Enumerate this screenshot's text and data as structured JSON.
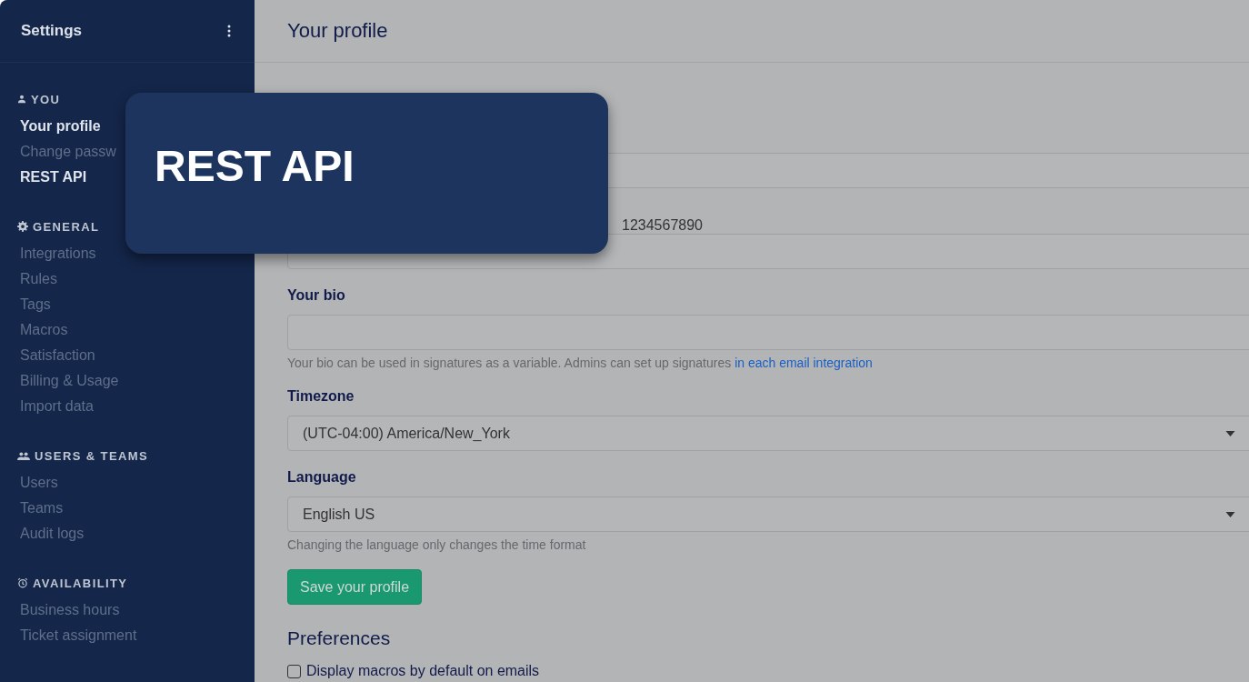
{
  "sidebar": {
    "title": "Settings",
    "sections": [
      {
        "heading": "YOU",
        "items": [
          {
            "label": "Your profile",
            "highlighted": true
          },
          {
            "label": "Change passw",
            "highlighted": false
          },
          {
            "label": "REST API",
            "highlighted": true
          }
        ]
      },
      {
        "heading": "GENERAL",
        "items": [
          {
            "label": "Integrations",
            "highlighted": false
          },
          {
            "label": "Rules",
            "highlighted": false
          },
          {
            "label": "Tags",
            "highlighted": false
          },
          {
            "label": "Macros",
            "highlighted": false
          },
          {
            "label": "Satisfaction",
            "highlighted": false
          },
          {
            "label": "Billing & Usage",
            "highlighted": false
          },
          {
            "label": "Import data",
            "highlighted": false
          }
        ]
      },
      {
        "heading": "USERS & TEAMS",
        "items": [
          {
            "label": "Users",
            "highlighted": false
          },
          {
            "label": "Teams",
            "highlighted": false
          },
          {
            "label": "Audit logs",
            "highlighted": false
          }
        ]
      },
      {
        "heading": "AVAILABILITY",
        "items": [
          {
            "label": "Business hours",
            "highlighted": false
          },
          {
            "label": "Ticket assignment",
            "highlighted": false
          }
        ]
      }
    ]
  },
  "page": {
    "title": "Your profile",
    "fields": [
      {
        "kind": "input"
      },
      {
        "kind": "input"
      },
      {
        "kind": "input",
        "label": "Your bio",
        "help": "Your bio can be used in signatures as a variable. Admins can set up signatures ",
        "help_link": "in each email integration"
      },
      {
        "kind": "select",
        "label": "Timezone",
        "value": "(UTC-04:00) America/New_York"
      },
      {
        "kind": "select",
        "label": "Language",
        "value": "English US",
        "help": "Changing the language only changes the time format"
      }
    ],
    "save_button": "Save your profile",
    "preferences": {
      "heading": "Preferences",
      "options": [
        {
          "label": "Display macros by default on emails",
          "checked": false
        }
      ]
    },
    "floating_text": "1234567890"
  },
  "callout": {
    "label": "REST API"
  }
}
